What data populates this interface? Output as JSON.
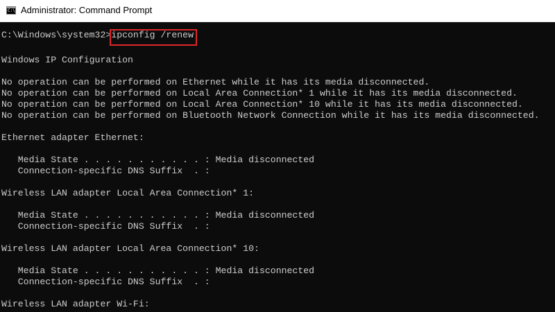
{
  "window": {
    "title": "Administrator: Command Prompt",
    "icon": "command-prompt-icon",
    "icon_text": "C:\\"
  },
  "console": {
    "prompt": "C:\\Windows\\system32>",
    "command": "ipconfig /renew",
    "lines": [
      "Windows IP Configuration",
      "",
      "No operation can be performed on Ethernet while it has its media disconnected.",
      "No operation can be performed on Local Area Connection* 1 while it has its media disconnected.",
      "No operation can be performed on Local Area Connection* 10 while it has its media disconnected.",
      "No operation can be performed on Bluetooth Network Connection while it has its media disconnected.",
      "",
      "Ethernet adapter Ethernet:",
      "",
      "   Media State . . . . . . . . . . . : Media disconnected",
      "   Connection-specific DNS Suffix  . :",
      "",
      "Wireless LAN adapter Local Area Connection* 1:",
      "",
      "   Media State . . . . . . . . . . . : Media disconnected",
      "   Connection-specific DNS Suffix  . :",
      "",
      "Wireless LAN adapter Local Area Connection* 10:",
      "",
      "   Media State . . . . . . . . . . . : Media disconnected",
      "   Connection-specific DNS Suffix  . :",
      "",
      "Wireless LAN adapter Wi-Fi:"
    ]
  },
  "colors": {
    "console_background": "#0c0c0c",
    "console_text": "#cccccc",
    "highlight": "#e0262a",
    "titlebar_background": "#ffffff"
  }
}
